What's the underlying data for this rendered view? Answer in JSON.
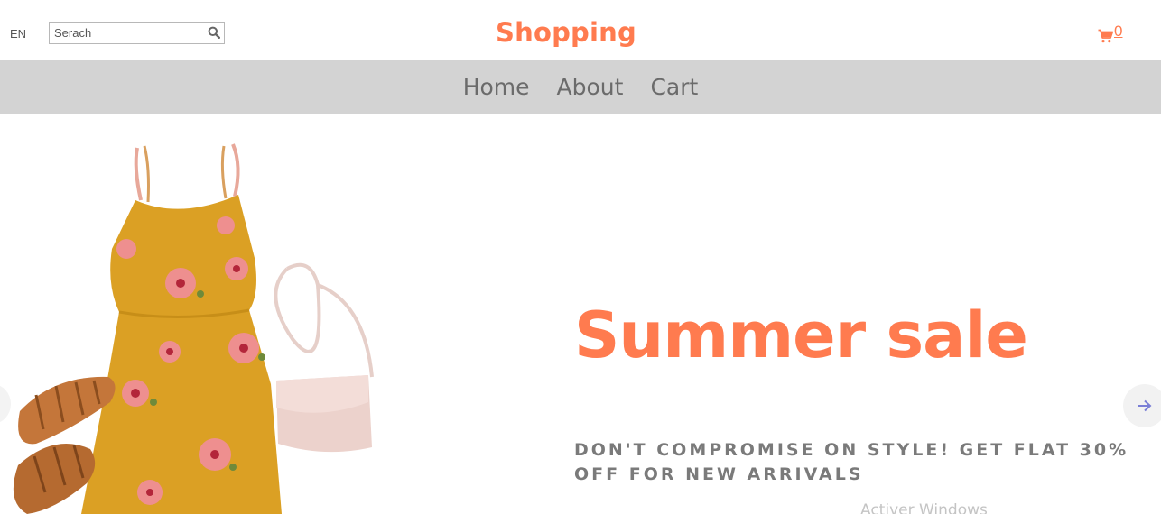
{
  "header": {
    "language": "EN",
    "search": {
      "placeholder": "Serach",
      "value": ""
    },
    "logo": "Shopping",
    "cart_count": "0",
    "accent_color": "#ff7b4f"
  },
  "nav": {
    "items": [
      {
        "label": "Home"
      },
      {
        "label": "About"
      },
      {
        "label": "Cart"
      }
    ],
    "background": "#d3d3d3"
  },
  "hero": {
    "title": "Summer sale",
    "subtitle": "DON'T COMPROMISE ON STYLE! GET FLAT 30% OFF FOR NEW ARRIVALS",
    "image": "summer-dress-product-image",
    "prev_icon": "arrow-left-icon",
    "next_icon": "arrow-right-icon"
  },
  "overlay": {
    "watermark": "Activer Windows"
  }
}
